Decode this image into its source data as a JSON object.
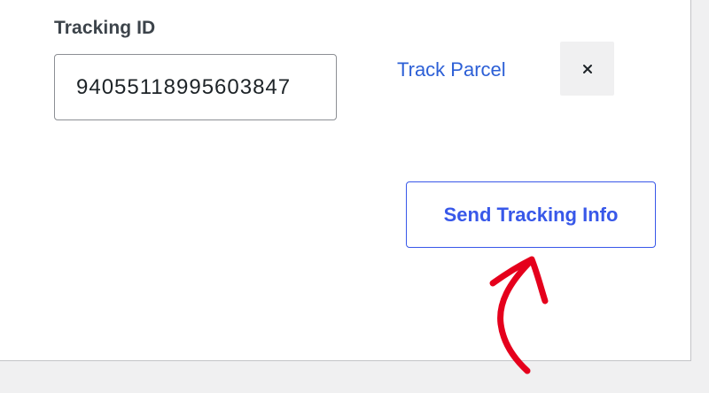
{
  "tracking_form": {
    "label": "Tracking ID",
    "tracking_id_value": "94055118995603847",
    "track_link_label": "Track Parcel",
    "remove_label": "×",
    "send_button_label": "Send Tracking Info"
  },
  "annotation": {
    "arrow_icon": "hand-drawn-arrow-icon",
    "arrow_color": "#e5001c"
  },
  "colors": {
    "accent": "#3858e9",
    "link": "#2c5fd6",
    "text": "#3c434a",
    "page_background": "#f0f0f1"
  }
}
